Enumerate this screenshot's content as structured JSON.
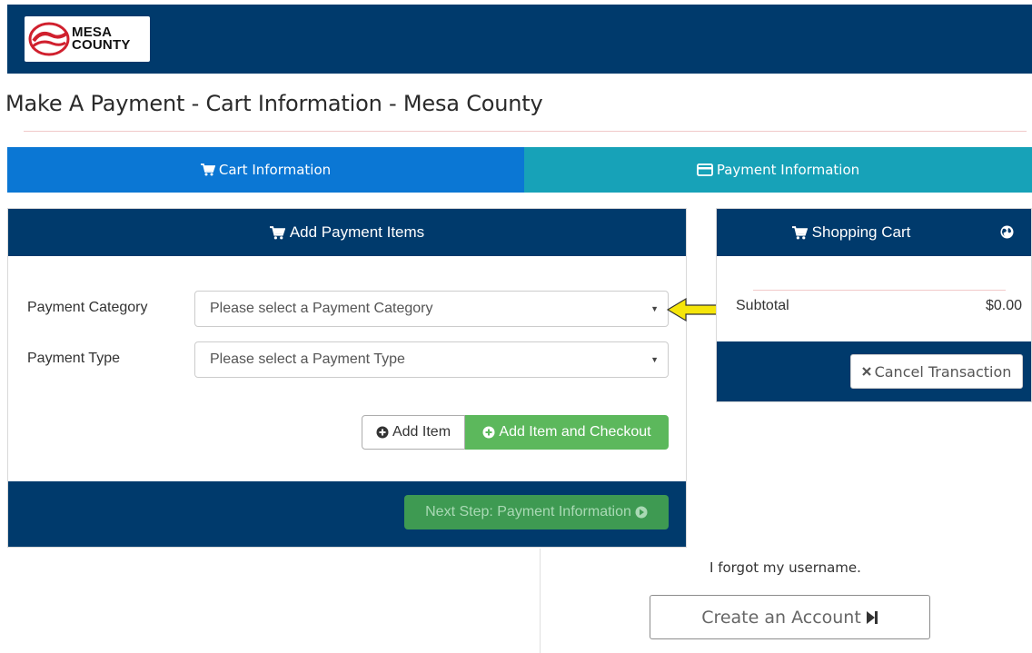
{
  "header": {
    "logo_line1": "MESA",
    "logo_line2": "COUNTY",
    "brand_color": "#003a6c"
  },
  "page": {
    "title": "Make A Payment - Cart Information - Mesa County"
  },
  "steps": {
    "cart_label": "Cart Information",
    "payment_label": "Payment Information",
    "active": "Cart Information"
  },
  "add_items": {
    "heading": "Add Payment Items",
    "category_label": "Payment Category",
    "category_placeholder": "Please select a Payment Category",
    "type_label": "Payment Type",
    "type_placeholder": "Please select a Payment Type",
    "add_item_label": "Add Item",
    "add_checkout_label": "Add Item and Checkout",
    "next_step_label": "Next Step: Payment Information"
  },
  "cart": {
    "heading": "Shopping Cart",
    "subtotal_label": "Subtotal",
    "subtotal_value": "$0.00",
    "cancel_label": "Cancel Transaction"
  },
  "account": {
    "forgot_username": "I forgot my username.",
    "create_account_label": "Create an Account"
  },
  "icons": {
    "cart": "cart-icon",
    "card": "credit-card-icon",
    "plus_circle": "plus-circle-icon",
    "arrow_circle": "arrow-circle-right-icon",
    "globe": "globe-icon",
    "times": "times-icon",
    "step_forward": "step-forward-icon"
  },
  "colors": {
    "step_active": "#0b77d4",
    "step_inactive": "#17a2b8",
    "success": "#5cb85c",
    "annotation_arrow": "#f5e50a"
  }
}
